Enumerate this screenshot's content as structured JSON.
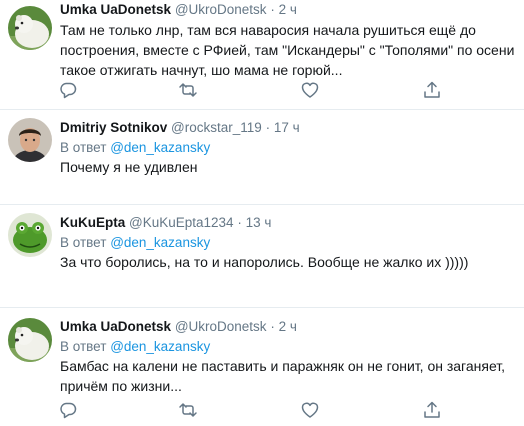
{
  "tweets": [
    {
      "author": "Umka UaDonetsk",
      "handle": "@UkroDonetsk",
      "separator": "·",
      "time": "2 ч",
      "text": "Там не только лнр, там вся наваросия начала рушиться ещё до построения, вместе с РФией, там \"Искандеры\" с \"Тополями\" по осени такое отжигать начнут, шо мама не горюй..."
    },
    {
      "author": "Dmitriy Sotnikov",
      "handle": "@rockstar_119",
      "separator": "·",
      "time": "17 ч",
      "reply_prefix": "В ответ",
      "reply_to": "@den_kazansky",
      "text": "Почему я не удивлен"
    },
    {
      "author": "KuKuEpta",
      "handle": "@KuKuEpta1234",
      "separator": "·",
      "time": "13 ч",
      "reply_prefix": "В ответ",
      "reply_to": "@den_kazansky",
      "text": "За что боролись, на то и напоролись. Вообще не жалко их )))))"
    },
    {
      "author": "Umka UaDonetsk",
      "handle": "@UkroDonetsk",
      "separator": "·",
      "time": "2 ч",
      "reply_prefix": "В ответ",
      "reply_to": "@den_kazansky",
      "text": "Бамбас на калени не паставить и паражняк он не гонит, он заганяет, причём по жизни..."
    }
  ],
  "icons": {
    "reply": "reply-icon",
    "retweet": "retweet-icon",
    "like": "like-icon",
    "share": "share-icon"
  },
  "colors": {
    "text": "#14171a",
    "secondary": "#657786",
    "link": "#1b95e0",
    "divider": "#e6ecf0"
  }
}
